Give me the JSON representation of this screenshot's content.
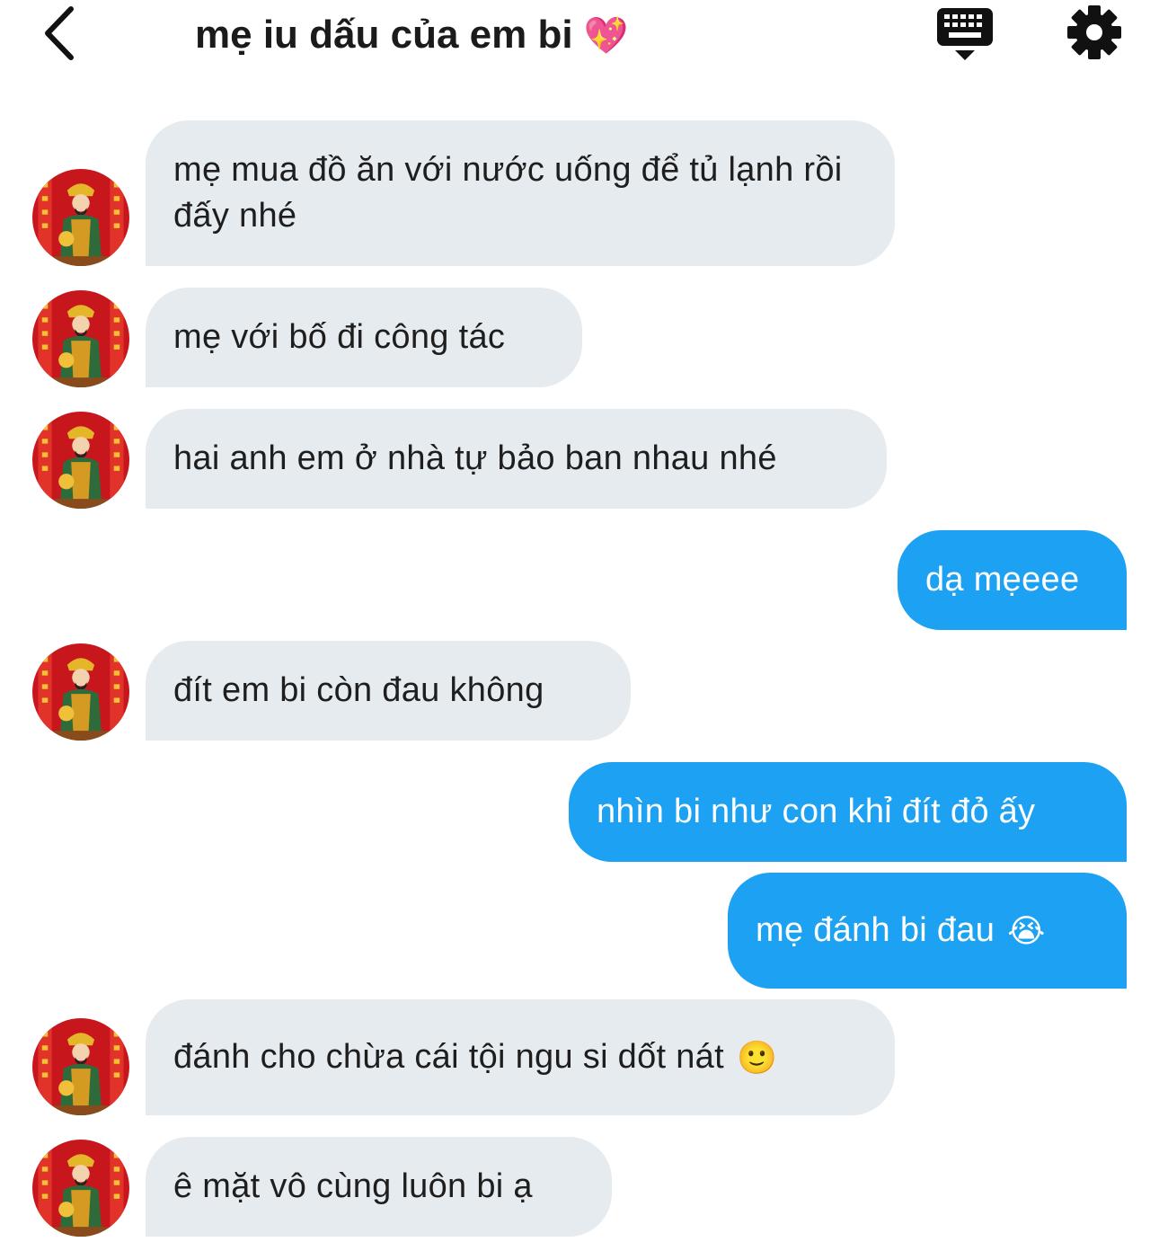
{
  "header": {
    "title": "mẹ iu dấu của em bi",
    "title_emoji": "💖"
  },
  "messages": [
    {
      "sender": "mom",
      "text": "mẹ mua đồ ăn với nước uống để tủ lạnh rồi đấy nhé",
      "emoji": ""
    },
    {
      "sender": "mom",
      "text": "mẹ với bố đi công tác",
      "emoji": ""
    },
    {
      "sender": "mom",
      "text": "hai anh em ở nhà tự bảo ban nhau nhé",
      "emoji": ""
    },
    {
      "sender": "me",
      "text": "dạ mẹeee",
      "emoji": ""
    },
    {
      "sender": "mom",
      "text": "đít em bi còn đau không",
      "emoji": ""
    },
    {
      "sender": "me",
      "text": "nhìn bi như con khỉ đít đỏ ấy",
      "emoji": ""
    },
    {
      "sender": "me",
      "text": "mẹ đánh bi đau",
      "emoji": "😭"
    },
    {
      "sender": "mom",
      "text": "đánh cho chừa cái tội ngu si dốt nát",
      "emoji": "🙂"
    },
    {
      "sender": "mom",
      "text": "ê mặt vô cùng luôn bi ạ",
      "emoji": ""
    }
  ],
  "colors": {
    "incoming_bubble": "#e6ebef",
    "outgoing_bubble": "#1da1f2",
    "text_dark": "#1e1e1e"
  },
  "icons": {
    "back": "chevron-left-icon",
    "keyboard": "keyboard-icon",
    "settings": "gear-icon"
  }
}
